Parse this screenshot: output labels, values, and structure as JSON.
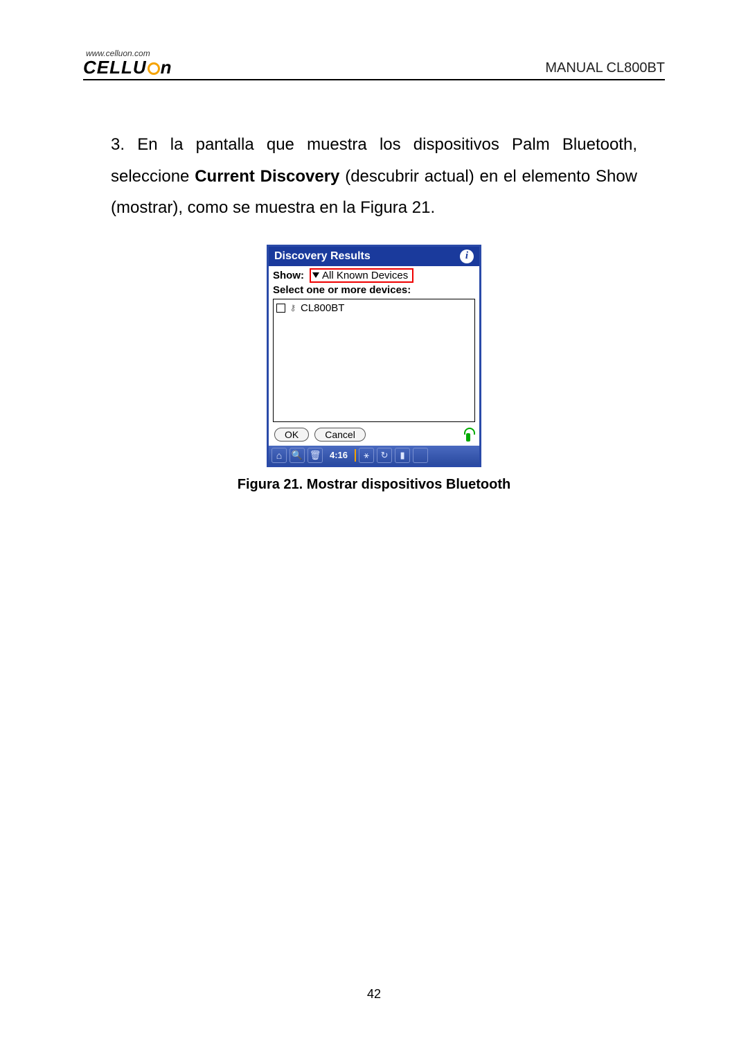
{
  "header": {
    "logo_url": "www.celluon.com",
    "brand_left": "CELLU",
    "brand_right": "n",
    "manual_label": "MANUAL CL800BT"
  },
  "body": {
    "step_prefix": "3. En la pantalla que muestra los dispositivos Palm Bluetooth, seleccione ",
    "bold_term": "Current Discovery",
    "step_suffix": " (descubrir actual) en el elemento Show (mostrar), como se muestra en la Figura 21."
  },
  "palm": {
    "title": "Discovery Results",
    "info_glyph": "i",
    "show_label": "Show:",
    "show_value": "All Known Devices",
    "select_label": "Select one or more devices:",
    "devices": [
      {
        "name": "CL800BT"
      }
    ],
    "ok_label": "OK",
    "cancel_label": "Cancel",
    "taskbar": {
      "time": "4:16",
      "icons": {
        "home": "⌂",
        "search": "🔍",
        "trash": "🗑",
        "bluetooth": "⚹",
        "sync": "↻",
        "battery": "▮"
      }
    }
  },
  "caption": "Figura 21. Mostrar dispositivos Bluetooth",
  "page_number": "42"
}
